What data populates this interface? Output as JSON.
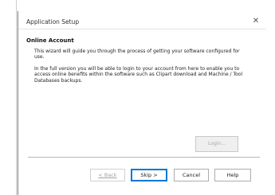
{
  "window": {
    "title": "Application Setup",
    "close_glyph": "✕"
  },
  "section": {
    "title": "Online Account",
    "paragraph1": "This wizard will guide you through the process of getting your software configured for use.",
    "paragraph2": "In the full version you will be able to login to your account from here to enable you to access online benefits within the software such as Clipart download and Machine / Tool Databases backups."
  },
  "login_button": {
    "label": "Login...",
    "enabled": false
  },
  "footer": {
    "back_label": "< Back",
    "skip_label": "Skip >",
    "cancel_label": "Cancel",
    "help_label": "Help"
  },
  "icons": {
    "close": "close-icon"
  },
  "colors": {
    "focus_border": "#0078d7",
    "disabled_text": "#a8a8a8"
  }
}
